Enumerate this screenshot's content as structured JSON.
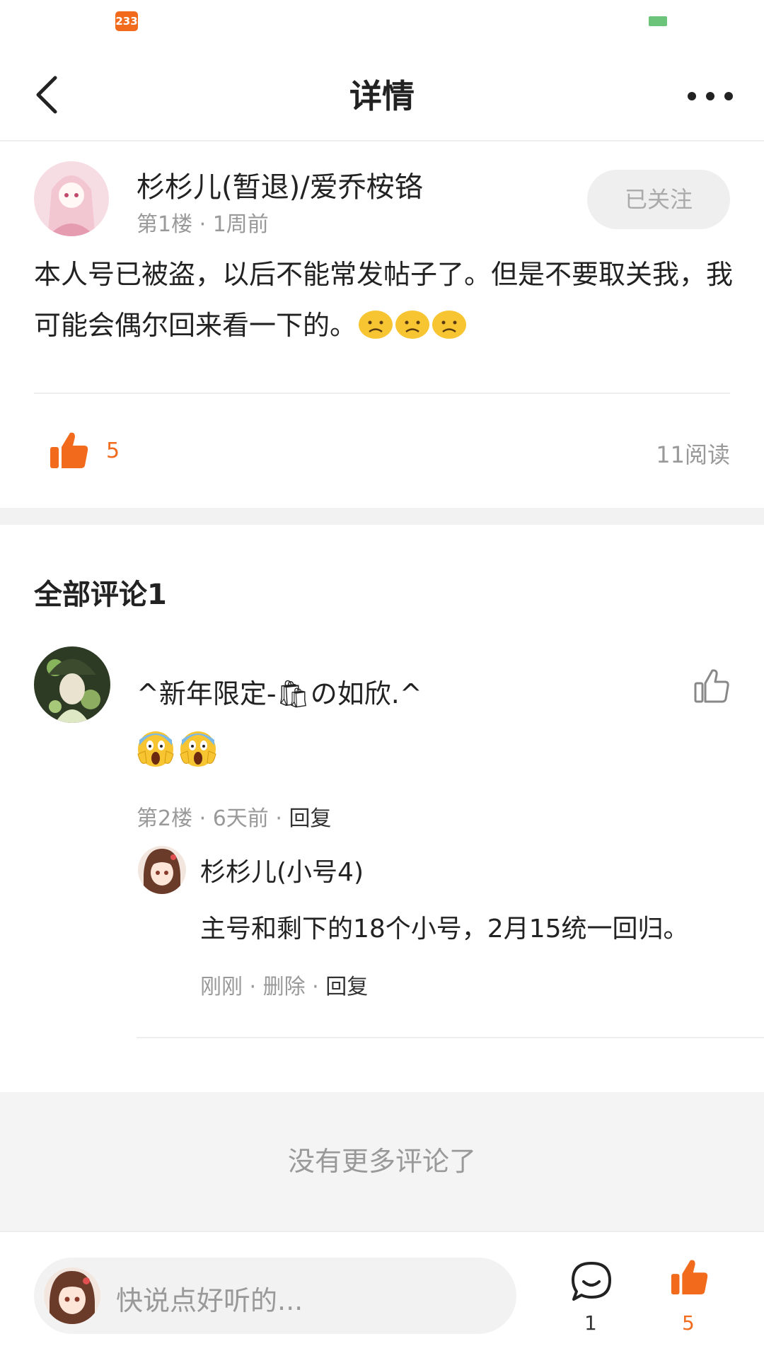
{
  "status_bar": {
    "badge": "233"
  },
  "header": {
    "title": "详情"
  },
  "post": {
    "author": "杉杉儿(暂退)/爱乔桉铬",
    "meta": "第1楼 · 1周前",
    "follow_label": "已关注",
    "body": "本人号已被盗，以后不能常发帖子了。但是不要取关我，我可能会偶尔回来看一下的。",
    "body_emoji": [
      "sad-face-emoji",
      "sad-face-emoji",
      "sad-face-emoji"
    ],
    "like_count": "5",
    "read_count": "11阅读"
  },
  "comments": {
    "header": "全部评论1",
    "items": [
      {
        "author": "^新年限定-🛍の如欣.^",
        "emoji": [
          "screaming-face-emoji",
          "screaming-face-emoji"
        ],
        "meta_floor": "第2楼",
        "meta_time": "6天前",
        "reply_label": "回复",
        "reply": {
          "author": "杉杉儿(小号4)",
          "text": "主号和剩下的18个小号，2月15统一回归。",
          "meta_time": "刚刚",
          "delete_label": "删除",
          "reply_label": "回复"
        }
      }
    ],
    "no_more": "没有更多评论了"
  },
  "bottom_bar": {
    "placeholder": "快说点好听的...",
    "comment_count": "1",
    "like_count": "5"
  },
  "colors": {
    "accent": "#f26b1d",
    "muted": "#999999",
    "divider": "#eeeeee"
  }
}
